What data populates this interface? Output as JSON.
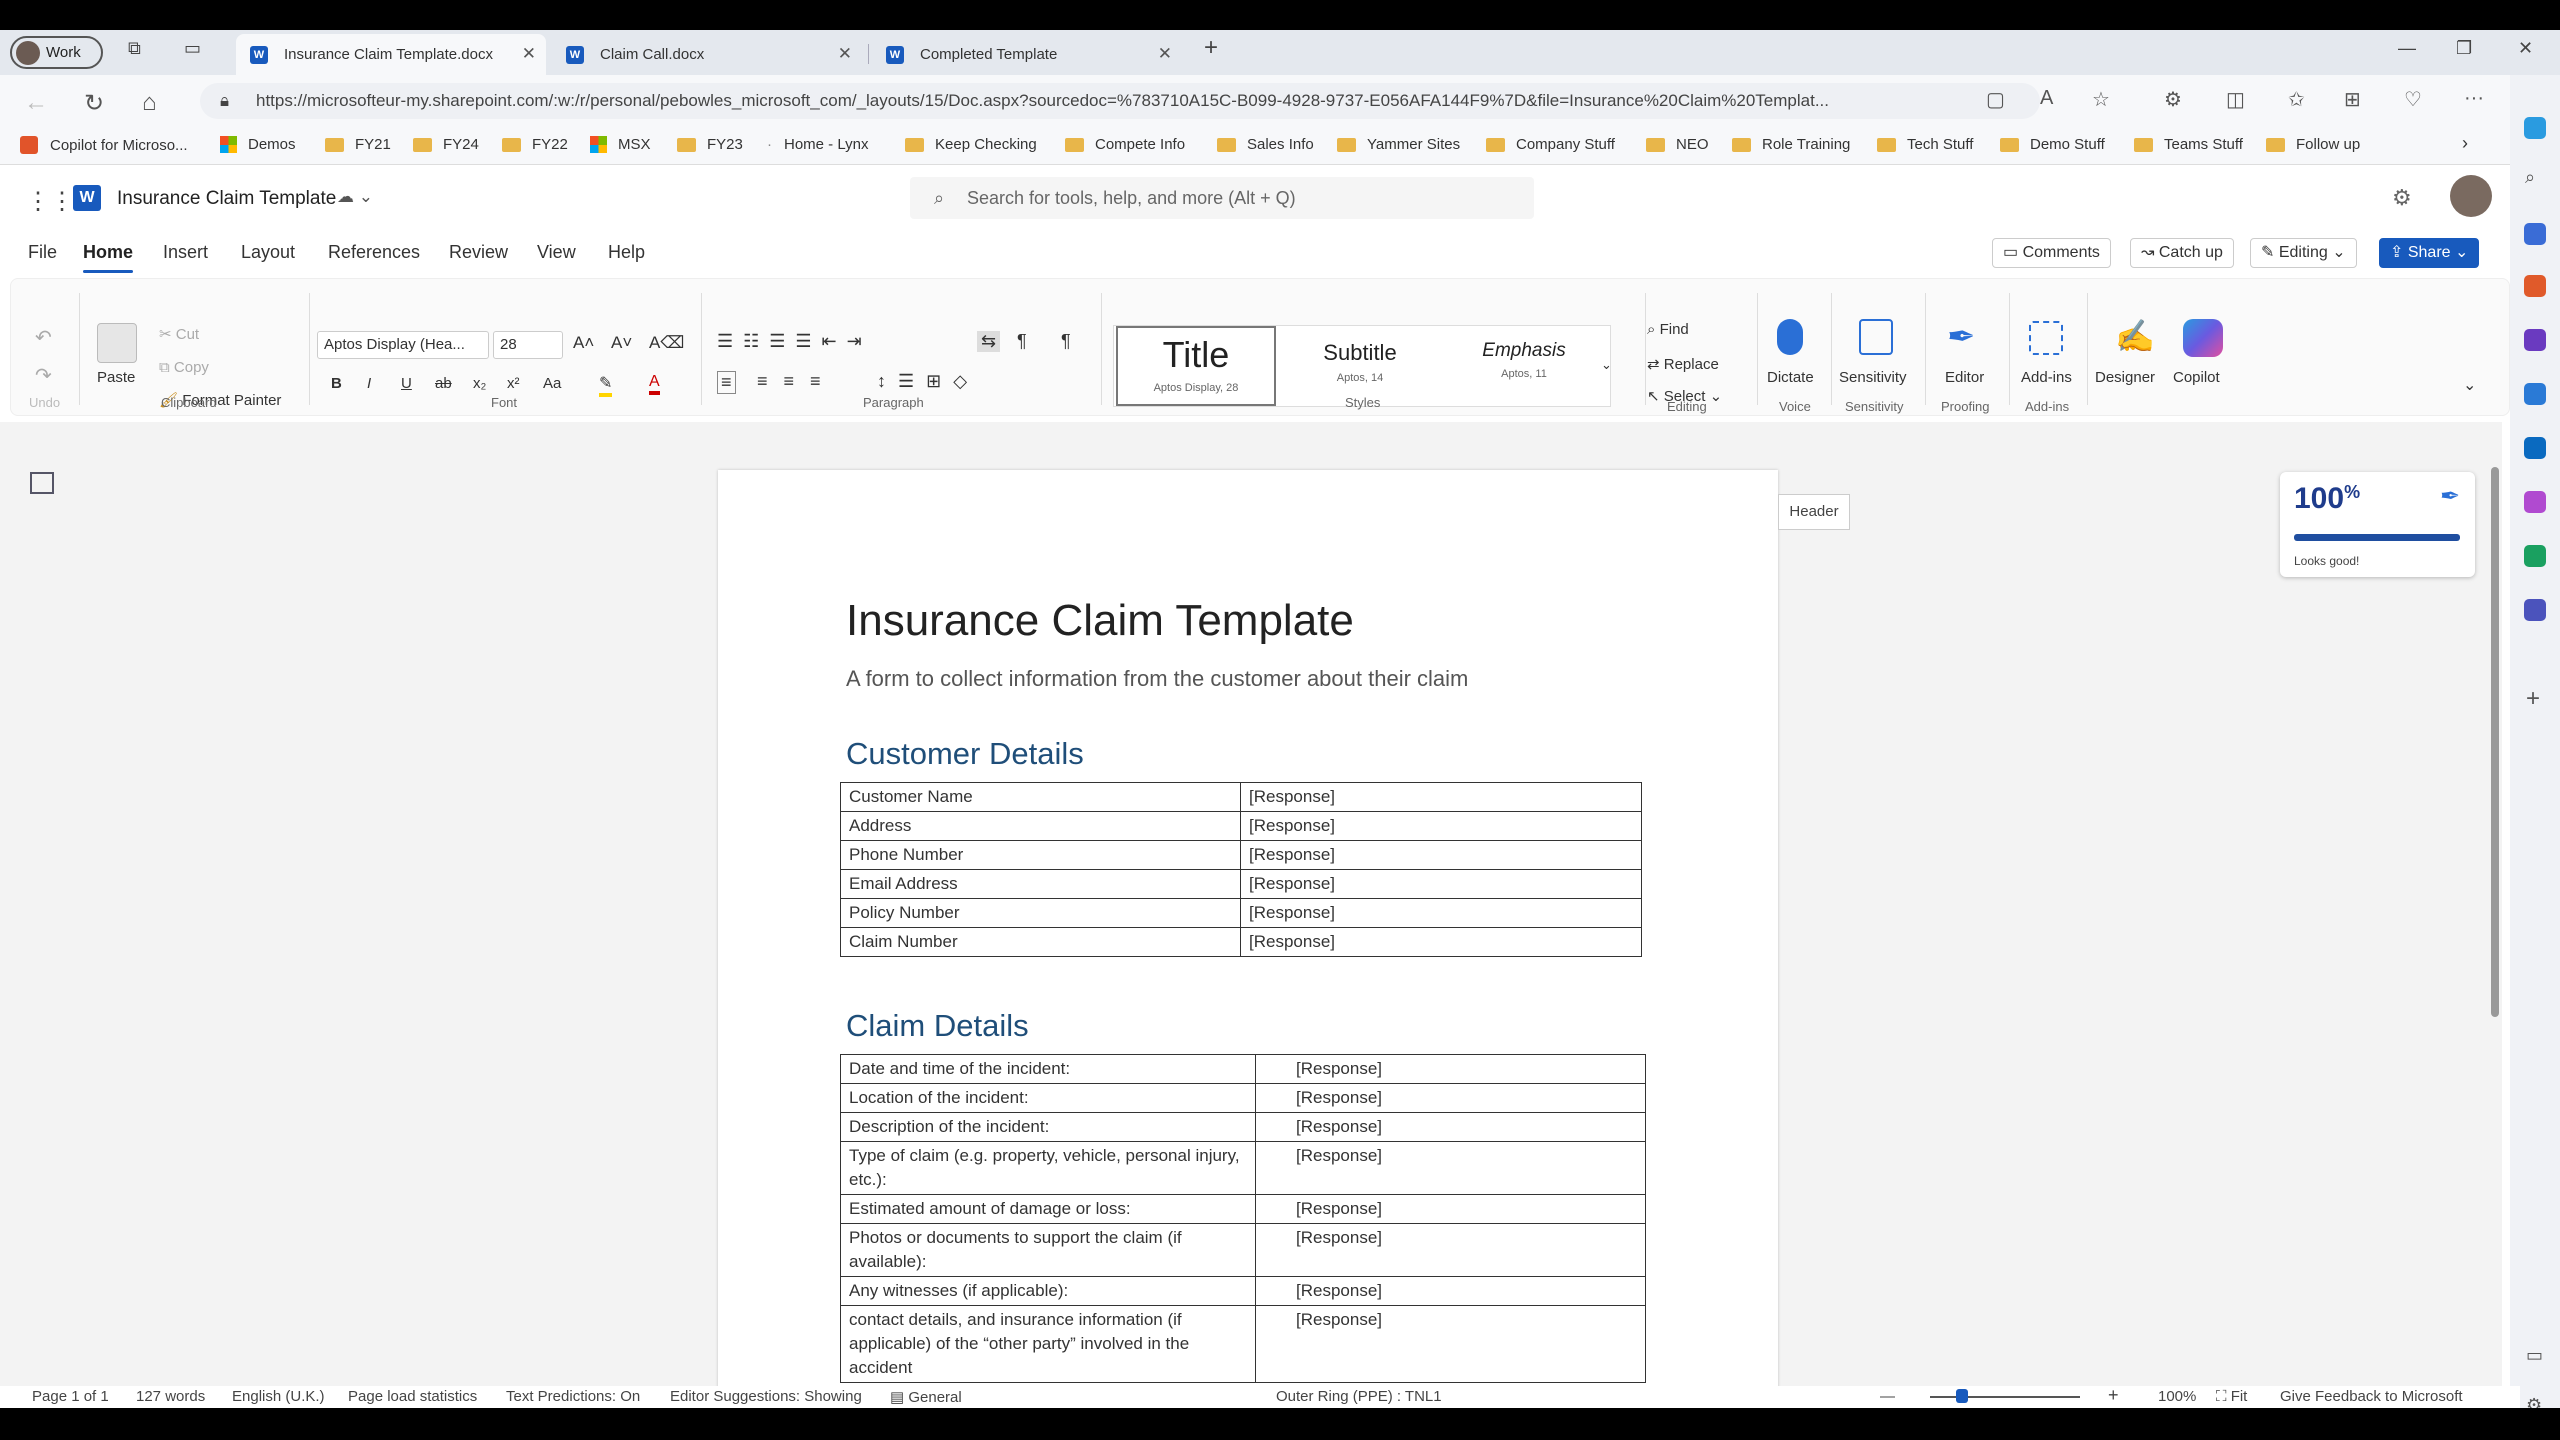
{
  "browser": {
    "profile": "Work",
    "tabs": [
      {
        "title": "Insurance Claim Template.docx",
        "active": true
      },
      {
        "title": "Claim Call.docx",
        "active": false
      },
      {
        "title": "Completed Template",
        "active": false
      }
    ],
    "url": "https://microsofteur-my.sharepoint.com/:w:/r/personal/pebowles_microsoft_com/_layouts/15/Doc.aspx?sourcedoc=%783710A15C-B099-4928-9737-E056AFA144F9%7D&file=Insurance%20Claim%20Templat...",
    "favorites": [
      "Copilot for Microso...",
      "Demos",
      "FY21",
      "FY24",
      "FY22",
      "MSX",
      "FY23",
      "Home - Lynx",
      "Keep Checking",
      "Compete Info",
      "Sales Info",
      "Yammer Sites",
      "Company Stuff",
      "NEO",
      "Role Training",
      "Tech Stuff",
      "Demo Stuff",
      "Teams Stuff",
      "Follow up"
    ]
  },
  "word": {
    "doc_title": "Insurance Claim Template",
    "search_placeholder": "Search for tools, help, and more (Alt + Q)",
    "menu": [
      "File",
      "Home",
      "Insert",
      "Layout",
      "References",
      "Review",
      "View",
      "Help"
    ],
    "header_buttons": {
      "comments": "Comments",
      "catchup": "Catch up",
      "editing": "Editing",
      "share": "Share"
    },
    "ribbon": {
      "undo_group": "Undo",
      "clipboard": {
        "paste": "Paste",
        "cut": "Cut",
        "copy": "Copy",
        "format_painter": "Format Painter",
        "label": "Clipboard"
      },
      "font": {
        "name": "Aptos Display (Hea...",
        "size": "28",
        "label": "Font"
      },
      "paragraph_label": "Paragraph",
      "styles": {
        "label": "Styles",
        "items": [
          {
            "name": "Title",
            "font": "Aptos Display, 28"
          },
          {
            "name": "Subtitle",
            "font": "Aptos, 14"
          },
          {
            "name": "Emphasis",
            "font": "Aptos, 11"
          }
        ]
      },
      "editing": {
        "find": "Find",
        "replace": "Replace",
        "select": "Select",
        "label": "Editing"
      },
      "dictate": "Dictate",
      "voice_label": "Voice",
      "sensitivity": "Sensitivity",
      "sensitivity_label": "Sensitivity",
      "editor": "Editor",
      "proofing_label": "Proofing",
      "addins": "Add-ins",
      "addins_label": "Add-ins",
      "designer": "Designer",
      "copilot": "Copilot"
    }
  },
  "document": {
    "title": "Insurance Claim Template",
    "subtitle": "A form to collect information from the customer about their claim",
    "sections": [
      {
        "heading": "Customer Details",
        "rows": [
          [
            "Customer Name",
            "[Response]"
          ],
          [
            "Address",
            "[Response]"
          ],
          [
            "Phone Number",
            "[Response]"
          ],
          [
            "Email Address",
            "[Response]"
          ],
          [
            "Policy Number",
            "[Response]"
          ],
          [
            "Claim Number",
            "[Response]"
          ]
        ]
      },
      {
        "heading": "Claim Details",
        "rows": [
          [
            "Date and time of the incident:",
            "[Response]"
          ],
          [
            "Location of the incident:",
            "[Response]"
          ],
          [
            "Description of the incident:",
            "[Response]"
          ],
          [
            "Type of claim (e.g. property, vehicle, personal injury, etc.):",
            "[Response]"
          ],
          [
            "Estimated amount of damage or loss:",
            "[Response]"
          ],
          [
            "Photos or documents to support the claim (if available):",
            "[Response]"
          ],
          [
            "Any witnesses (if applicable):",
            "[Response]"
          ],
          [
            " contact details, and insurance information (if applicable) of the “other party” involved in the accident",
            "[Response]"
          ]
        ]
      }
    ],
    "header_tag": "Header",
    "editor_score": {
      "value": "100",
      "unit": "%",
      "note": "Looks good!",
      "fill_fraction": 1.0
    }
  },
  "status": {
    "page": "Page 1 of 1",
    "words": "127 words",
    "language": "English (U.K.)",
    "page_load": "Page load statistics",
    "text_predictions": "Text Predictions: On",
    "editor_suggestions": "Editor Suggestions: Showing",
    "sensitivity": "General",
    "ring": "Outer Ring (PPE) : TNL1",
    "zoom": "100%",
    "fit": "Fit",
    "feedback": "Give Feedback to Microsoft"
  }
}
